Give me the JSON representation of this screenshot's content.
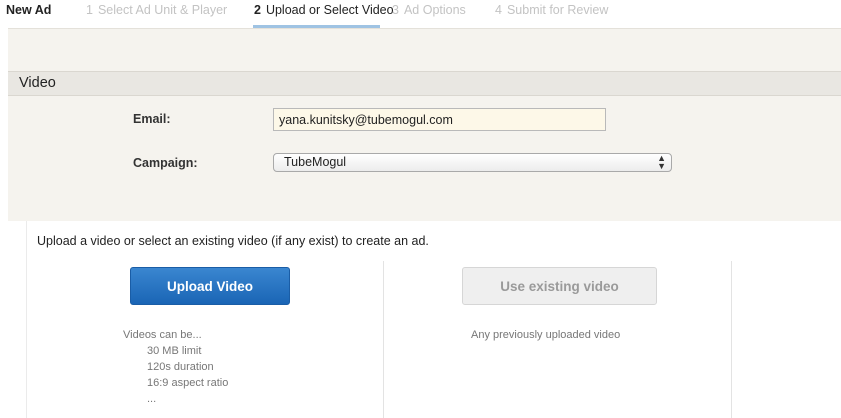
{
  "nav": {
    "title": "New Ad",
    "steps": [
      {
        "num": "1",
        "label": "Select Ad Unit & Player"
      },
      {
        "num": "2",
        "label": "Upload or Select Video"
      },
      {
        "num": "3",
        "label": "Ad Options"
      },
      {
        "num": "4",
        "label": "Submit for Review"
      }
    ],
    "active_step": 2
  },
  "section": {
    "title": "Video"
  },
  "form": {
    "email_label": "Email:",
    "email_value": "yana.kunitsky@tubemogul.com",
    "campaign_label": "Campaign:",
    "campaign_value": "TubeMogul"
  },
  "upload": {
    "intro": "Upload a video or select an existing video (if any exist) to create an ad.",
    "upload_button": "Upload Video",
    "existing_button": "Use existing video",
    "requirements_title": "Videos can be...",
    "requirements": [
      "30 MB limit",
      "120s duration",
      "16:9 aspect ratio",
      "..."
    ],
    "existing_note": "Any previously uploaded video"
  },
  "colors": {
    "primary": "#2a76c4",
    "active_underline": "#9fc3e3",
    "panel_bg": "#f5f3ee"
  }
}
